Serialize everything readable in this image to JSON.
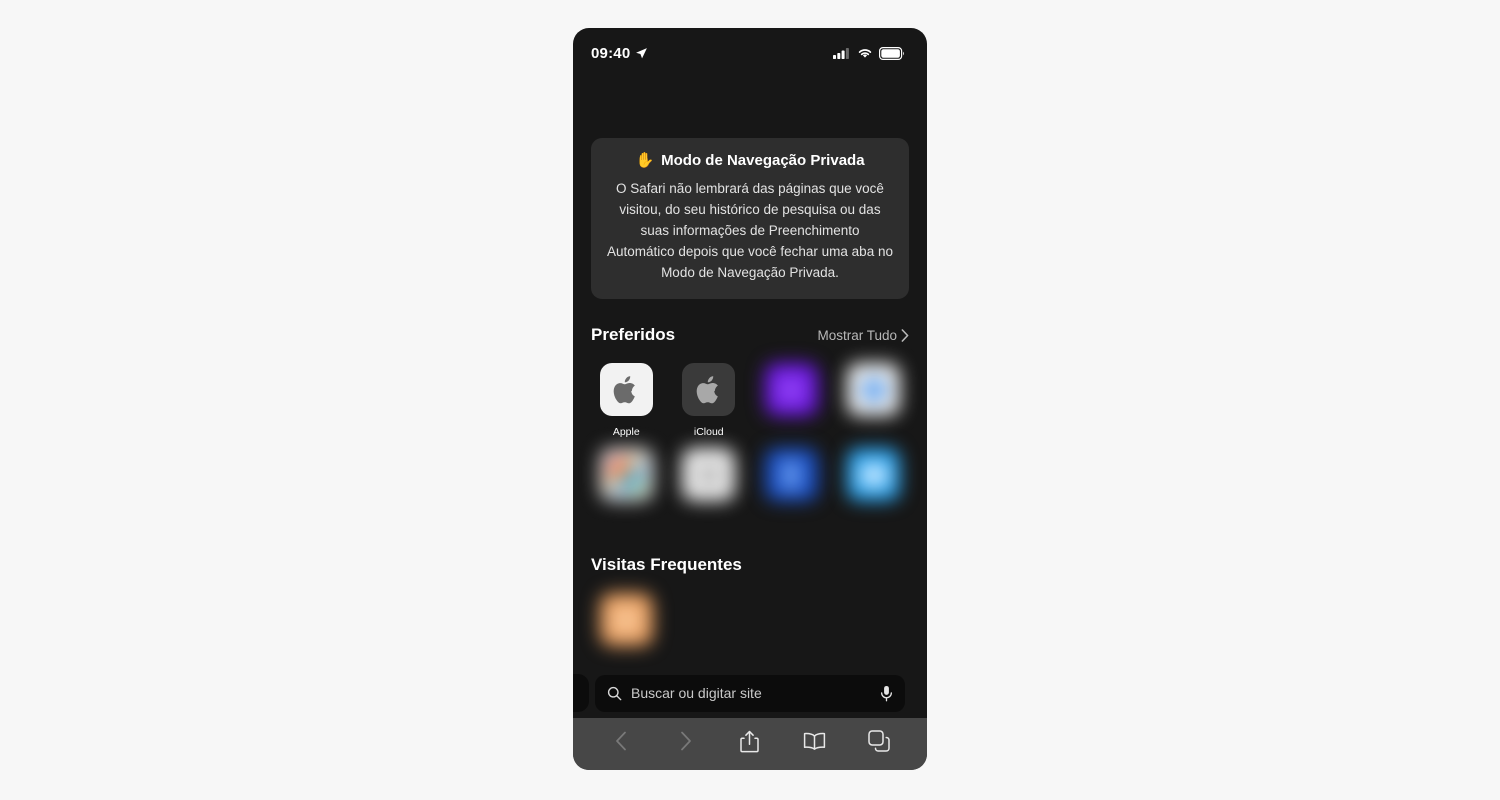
{
  "status_bar": {
    "time": "09:40",
    "location_icon": "location-arrow-icon",
    "signal_icon": "cellular-signal-icon",
    "wifi_icon": "wifi-icon",
    "battery_icon": "battery-full-icon"
  },
  "private_banner": {
    "icon": "raised-hand-icon",
    "hand_glyph": "✋",
    "title": "Modo de Navegação Privada",
    "body": "O Safari não lembrará das páginas que você visitou, do seu histórico de pesquisa ou das suas informações de Preenchimento Automático depois que você fechar uma aba no Modo de Navegação Privada."
  },
  "favorites": {
    "title": "Preferidos",
    "show_all_label": "Mostrar Tudo",
    "show_all_icon": "chevron-right-icon",
    "items": [
      {
        "label": "Apple",
        "tile_color": "#f2f2f2",
        "glyph_color": "#6b6b6b",
        "icon": "apple-logo-icon",
        "blurred": false
      },
      {
        "label": "iCloud",
        "tile_color": "#3a3a3a",
        "glyph_color": "#a8a8a8",
        "icon": "apple-logo-icon",
        "blurred": false
      },
      {
        "label": "",
        "tile_color": "#6a16e0",
        "glyph_color": "#8a3bf0",
        "icon": "favorite-site-icon",
        "blurred": true
      },
      {
        "label": "",
        "tile_color": "#f0f0f0",
        "glyph_color": "#6aa8f0",
        "icon": "favorite-site-icon",
        "blurred": true
      },
      {
        "label": "",
        "tile_color": "#dcdcdc",
        "glyph_color": "#d06a5a",
        "icon": "favorite-site-icon",
        "blurred": true
      },
      {
        "label": "",
        "tile_color": "#ededed",
        "glyph_color": "#b5b5b5",
        "icon": "favorite-site-icon",
        "blurred": true
      },
      {
        "label": "",
        "tile_color": "#1a4fc4",
        "glyph_color": "#5f92e8",
        "icon": "favorite-site-icon",
        "blurred": true
      },
      {
        "label": "",
        "tile_color": "#2aa3ee",
        "glyph_color": "#bfe4ff",
        "icon": "favorite-site-icon",
        "blurred": true
      }
    ]
  },
  "frequent": {
    "title": "Visitas Frequentes",
    "items": [
      {
        "label": "",
        "tile_color": "#eda161",
        "glyph_color": "#f5bf8d",
        "icon": "frequent-site-icon",
        "blurred": true
      }
    ]
  },
  "bottom_bar": {
    "search": {
      "placeholder": "Buscar ou digitar site",
      "value": "",
      "search_icon": "search-icon",
      "mic_icon": "microphone-icon"
    },
    "toolbar": [
      {
        "name": "back-button",
        "icon": "chevron-left-icon",
        "disabled": true
      },
      {
        "name": "forward-button",
        "icon": "chevron-right-icon",
        "disabled": true
      },
      {
        "name": "share-button",
        "icon": "share-icon",
        "disabled": false
      },
      {
        "name": "bookmarks-button",
        "icon": "book-icon",
        "disabled": false
      },
      {
        "name": "tabs-button",
        "icon": "tabs-icon",
        "disabled": false
      }
    ]
  },
  "theme": {
    "page_background": "#f7f7f7",
    "phone_background": "#171717",
    "card_background": "#2e2e2e",
    "toolbar_background": "#474747",
    "search_background": "#0c0c0c",
    "text_primary": "#ffffff",
    "text_secondary": "#b8b8b8"
  }
}
